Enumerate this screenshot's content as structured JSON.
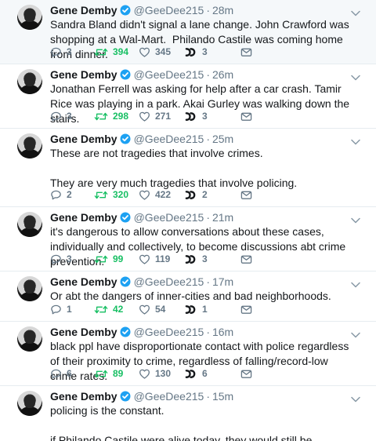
{
  "colors": {
    "retweet_active": "#17bf63",
    "meta_gray": "#657786",
    "verified_blue": "#1da1f2",
    "highlight_bg": "#f5f8fa"
  },
  "icons": [
    "reply-icon",
    "retweet-icon",
    "like-icon",
    "moments-icon",
    "direct-message-icon",
    "verified-badge-icon",
    "chevron-down-icon"
  ],
  "tweets": [
    {
      "name": "Gene Demby",
      "handle": "@GeeDee215",
      "time": "28m",
      "text": "Sandra Bland didn't signal a lane change. John Crawford was shopping at a Wal-Mart.  Philando Castile was coming home from dinner.",
      "replies": "3",
      "retweets": "394",
      "likes": "345",
      "moments": "3"
    },
    {
      "name": "Gene Demby",
      "handle": "@GeeDee215",
      "time": "26m",
      "text": "Jonathan Ferrell was asking for help after a car crash. Tamir Rice was playing in a park. Akai Gurley was walking down the stairs.",
      "replies": "3",
      "retweets": "298",
      "likes": "271",
      "moments": "3"
    },
    {
      "name": "Gene Demby",
      "handle": "@GeeDee215",
      "time": "25m",
      "text": "These are not tragedies that involve crimes.\n\nThey are very much tragedies that involve policing.",
      "replies": "2",
      "retweets": "320",
      "likes": "422",
      "moments": "2"
    },
    {
      "name": "Gene Demby",
      "handle": "@GeeDee215",
      "time": "21m",
      "text": "it's dangerous to allow conversations about these cases, individually and collectively, to become discussions abt crime prevention.",
      "replies": "3",
      "retweets": "99",
      "likes": "119",
      "moments": "3"
    },
    {
      "name": "Gene Demby",
      "handle": "@GeeDee215",
      "time": "17m",
      "text": "Or abt the dangers of inner-cities and bad neighborhoods.",
      "replies": "1",
      "retweets": "42",
      "likes": "54",
      "moments": "1"
    },
    {
      "name": "Gene Demby",
      "handle": "@GeeDee215",
      "time": "16m",
      "text": "black ppl have disproportionate contact with police regardless of their proximity to crime, regardless of falling/record-low crime rates.",
      "replies": "6",
      "retweets": "89",
      "likes": "130",
      "moments": "6"
    },
    {
      "name": "Gene Demby",
      "handle": "@GeeDee215",
      "time": "15m",
      "text": "policing is the constant.\n\nif Philando Castile were alive today, they would still be stopping him.",
      "replies": "",
      "retweets": "",
      "likes": "",
      "moments": ""
    }
  ]
}
